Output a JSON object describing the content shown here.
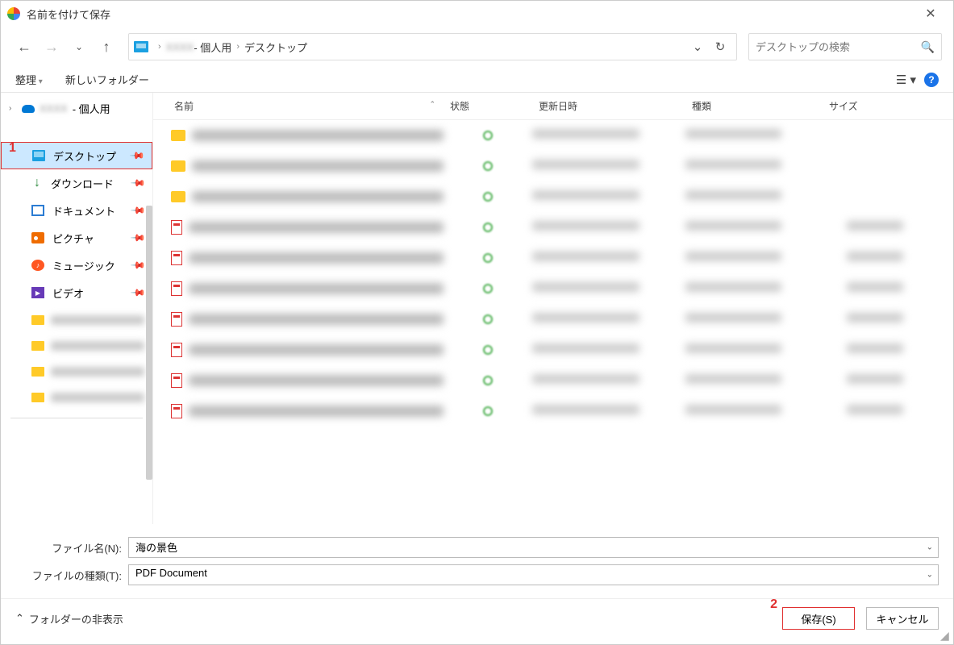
{
  "title": "名前を付けて保存",
  "breadcrumb": {
    "personal_suffix": " - 個人用",
    "desktop": "デスクトップ"
  },
  "search": {
    "placeholder": "デスクトップの検索"
  },
  "toolbar": {
    "organize": "整理",
    "new_folder": "新しいフォルダー"
  },
  "sidebar": {
    "onedrive_suffix": " - 個人用",
    "items": [
      {
        "label": "デスクトップ"
      },
      {
        "label": "ダウンロード"
      },
      {
        "label": "ドキュメント"
      },
      {
        "label": "ピクチャ"
      },
      {
        "label": "ミュージック"
      },
      {
        "label": "ビデオ"
      }
    ]
  },
  "columns": {
    "name": "名前",
    "state": "状態",
    "date": "更新日時",
    "type": "種類",
    "size": "サイズ"
  },
  "form": {
    "filename_label": "ファイル名(N):",
    "filename_value": "海の景色",
    "filetype_label": "ファイルの種類(T):",
    "filetype_value": "PDF Document"
  },
  "footer": {
    "hide_folders": "フォルダーの非表示",
    "save": "保存(S)",
    "cancel": "キャンセル"
  },
  "annotations": {
    "one": "1",
    "two": "2"
  }
}
